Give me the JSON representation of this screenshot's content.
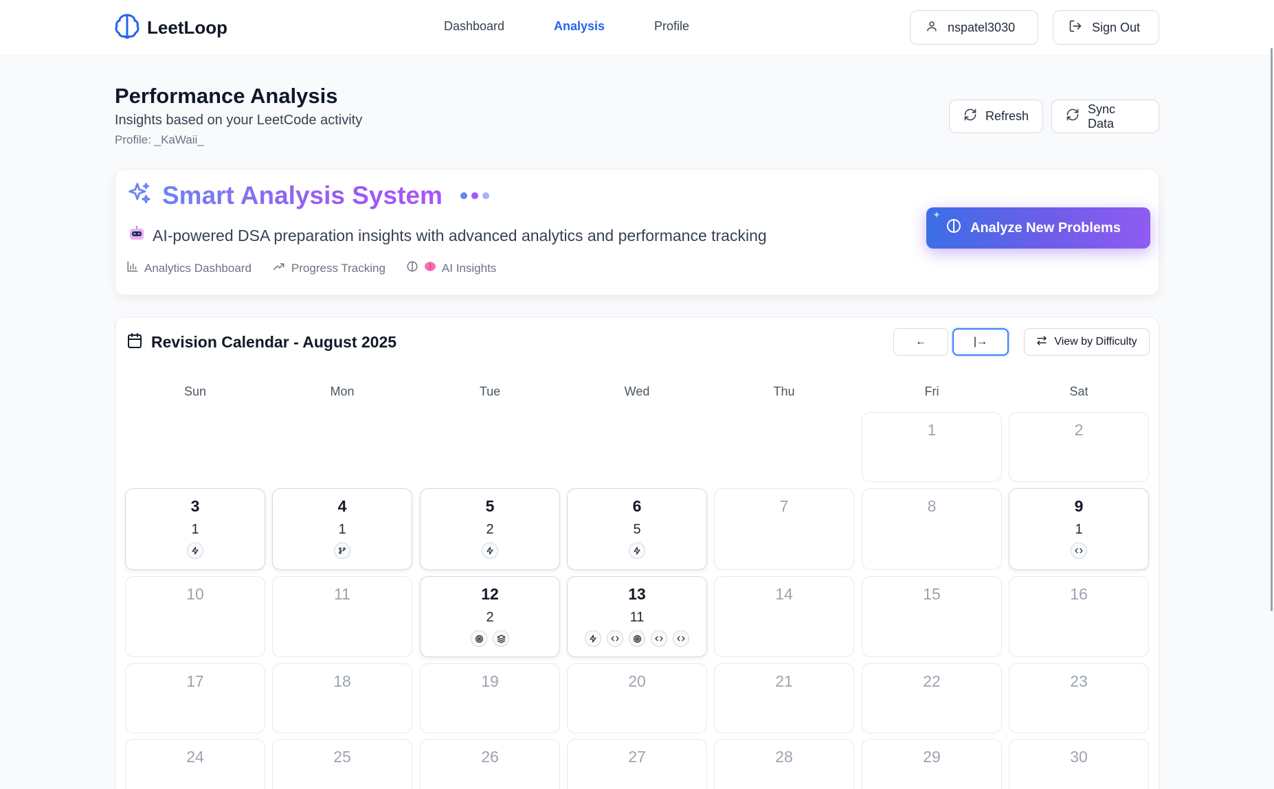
{
  "header": {
    "brand": "LeetLoop",
    "nav": [
      {
        "label": "Dashboard"
      },
      {
        "label": "Analysis",
        "active": true
      },
      {
        "label": "Profile"
      }
    ],
    "user": "nspatel3030",
    "sign_out": "Sign Out"
  },
  "page": {
    "title": "Performance Analysis",
    "subtitle": "Insights based on your LeetCode activity",
    "profile": "Profile: _KaWaii_",
    "refresh": "Refresh",
    "sync": "Sync Data"
  },
  "smart": {
    "title": "Smart Analysis System",
    "desc": "AI-powered DSA preparation insights with advanced analytics and performance tracking",
    "tags": [
      "Analytics Dashboard",
      "Progress Tracking",
      "AI Insights"
    ],
    "analyze": "Analyze New Problems",
    "colors": {
      "dot1": "#6d83f2",
      "dot2": "#a855f7",
      "dot3": "#a5b4fc"
    }
  },
  "calendar": {
    "title": "Revision Calendar - August 2025",
    "prev": "←",
    "today": "|→",
    "view": "View by Difficulty",
    "weekdays": [
      "Sun",
      "Mon",
      "Tue",
      "Wed",
      "Thu",
      "Fri",
      "Sat"
    ],
    "days": [
      {
        "day": "1",
        "col": 5,
        "row": 0
      },
      {
        "day": "2",
        "col": 6,
        "row": 0
      },
      {
        "day": "3",
        "col": 0,
        "row": 1,
        "count": "1",
        "icons": [
          "bolt-icon"
        ]
      },
      {
        "day": "4",
        "col": 1,
        "row": 1,
        "count": "1",
        "icons": [
          "branch-icon"
        ]
      },
      {
        "day": "5",
        "col": 2,
        "row": 1,
        "count": "2",
        "icons": [
          "bolt-icon"
        ]
      },
      {
        "day": "6",
        "col": 3,
        "row": 1,
        "count": "5",
        "icons": [
          "bolt-icon"
        ]
      },
      {
        "day": "7",
        "col": 4,
        "row": 1
      },
      {
        "day": "8",
        "col": 5,
        "row": 1
      },
      {
        "day": "9",
        "col": 6,
        "row": 1,
        "count": "1",
        "icons": [
          "code-icon"
        ]
      },
      {
        "day": "10",
        "col": 0,
        "row": 2
      },
      {
        "day": "11",
        "col": 1,
        "row": 2
      },
      {
        "day": "12",
        "col": 2,
        "row": 2,
        "count": "2",
        "icons": [
          "target-icon",
          "layers-icon"
        ]
      },
      {
        "day": "13",
        "col": 3,
        "row": 2,
        "count": "11",
        "icons": [
          "bolt-icon",
          "code-icon",
          "target-icon",
          "code-icon",
          "code-icon"
        ]
      },
      {
        "day": "14",
        "col": 4,
        "row": 2
      },
      {
        "day": "15",
        "col": 5,
        "row": 2
      },
      {
        "day": "16",
        "col": 6,
        "row": 2
      },
      {
        "day": "17",
        "col": 0,
        "row": 3
      },
      {
        "day": "18",
        "col": 1,
        "row": 3
      },
      {
        "day": "19",
        "col": 2,
        "row": 3
      },
      {
        "day": "20",
        "col": 3,
        "row": 3
      },
      {
        "day": "21",
        "col": 4,
        "row": 3
      },
      {
        "day": "22",
        "col": 5,
        "row": 3
      },
      {
        "day": "23",
        "col": 6,
        "row": 3
      },
      {
        "day": "24",
        "col": 0,
        "row": 4
      },
      {
        "day": "25",
        "col": 1,
        "row": 4
      },
      {
        "day": "26",
        "col": 2,
        "row": 4
      },
      {
        "day": "27",
        "col": 3,
        "row": 4
      },
      {
        "day": "28",
        "col": 4,
        "row": 4
      },
      {
        "day": "29",
        "col": 5,
        "row": 4
      },
      {
        "day": "30",
        "col": 6,
        "row": 4
      }
    ]
  }
}
